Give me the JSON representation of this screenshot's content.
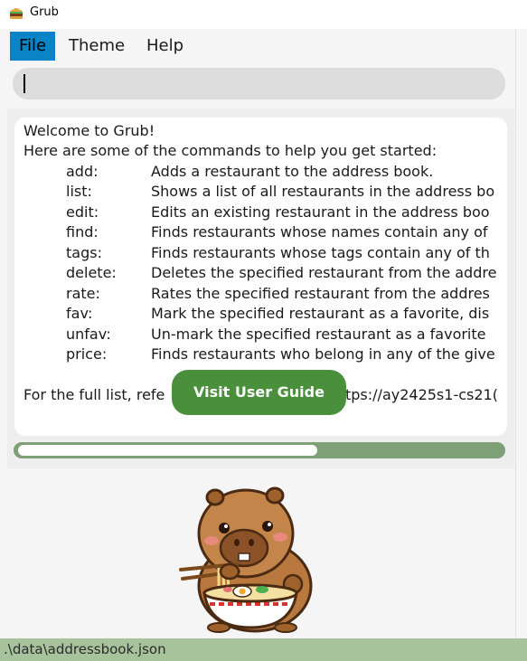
{
  "window": {
    "title": "Grub",
    "icon": "burger-icon"
  },
  "menu": {
    "items": [
      "File",
      "Theme",
      "Help"
    ],
    "active": "File"
  },
  "command_box": {
    "value": "",
    "placeholder": ""
  },
  "result": {
    "welcome": "Welcome to Grub!",
    "intro": "Here are some of the commands to help you get started:",
    "commands": [
      {
        "name": "add:",
        "desc": "Adds a restaurant to the address book."
      },
      {
        "name": "list:",
        "desc": "Shows a list of all restaurants in the address bo"
      },
      {
        "name": "edit:",
        "desc": "Edits an existing restaurant in the address boo"
      },
      {
        "name": "find:",
        "desc": "Finds restaurants whose names contain any of"
      },
      {
        "name": "tags:",
        "desc": "Finds restaurants whose tags contain any of th"
      },
      {
        "name": "delete:",
        "desc": "Deletes the specified restaurant from the addre"
      },
      {
        "name": "rate:",
        "desc": "Rates the specified restaurant from the addres"
      },
      {
        "name": "fav:",
        "desc": "Mark the specified restaurant as a favorite, dis"
      },
      {
        "name": "unfav:",
        "desc": "Un-mark the specified restaurant as a favorite"
      },
      {
        "name": "price:",
        "desc": "Finds restaurants who belong in any of the give"
      }
    ],
    "footer_left": "For the full list, refe",
    "footer_right": "tps://ay2425s1-cs21(",
    "guide_button": "Visit User Guide"
  },
  "scrollbar": {
    "horizontal_fraction": 0.62
  },
  "mascot": {
    "icon": "capybara-ramen-mascot"
  },
  "status": {
    "path": ".\\data\\addressbook.json"
  },
  "colors": {
    "accent": "#0a84c7",
    "button_green": "#4a8f3c",
    "status_green": "#a7c39c",
    "scroll_track": "#7f9f76"
  }
}
